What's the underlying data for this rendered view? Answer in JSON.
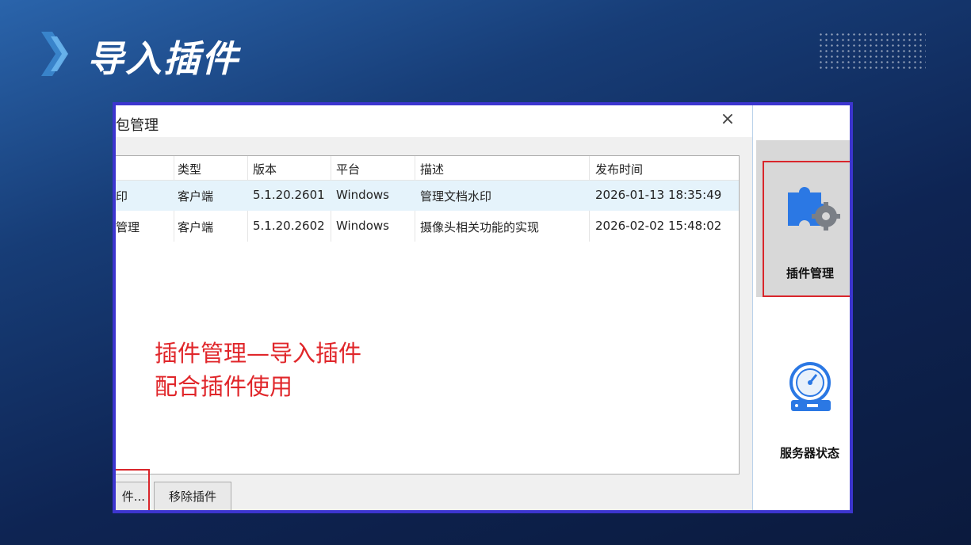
{
  "slide": {
    "title": "导入插件"
  },
  "dialog": {
    "title": "包管理",
    "close_glyph": "×",
    "columns": [
      "类型",
      "版本",
      "平台",
      "描述",
      "发布时间"
    ],
    "rows": [
      {
        "name": "印",
        "type": "客户端",
        "version": "5.1.20.2601",
        "platform": "Windows",
        "desc": "管理文档水印",
        "date": "2026-01-13 18:35:49"
      },
      {
        "name": "管理",
        "type": "客户端",
        "version": "5.1.20.2602",
        "platform": "Windows",
        "desc": "摄像头相关功能的实现",
        "date": "2026-02-02 15:48:02"
      }
    ],
    "annotation": [
      "插件管理—导入插件",
      "配合插件使用"
    ],
    "import_button": "件...",
    "remove_button": "移除插件"
  },
  "sidebar": {
    "plugin_manage": "插件管理",
    "server_status": "服务器状态"
  },
  "colors": {
    "accent_red": "#e0262a",
    "frame_blue": "#3c35cf",
    "plugin_blue": "#2b78e4"
  },
  "icons": [
    "chevron-right-icon",
    "close-icon",
    "puzzle-gear-icon",
    "server-gauge-icon"
  ]
}
